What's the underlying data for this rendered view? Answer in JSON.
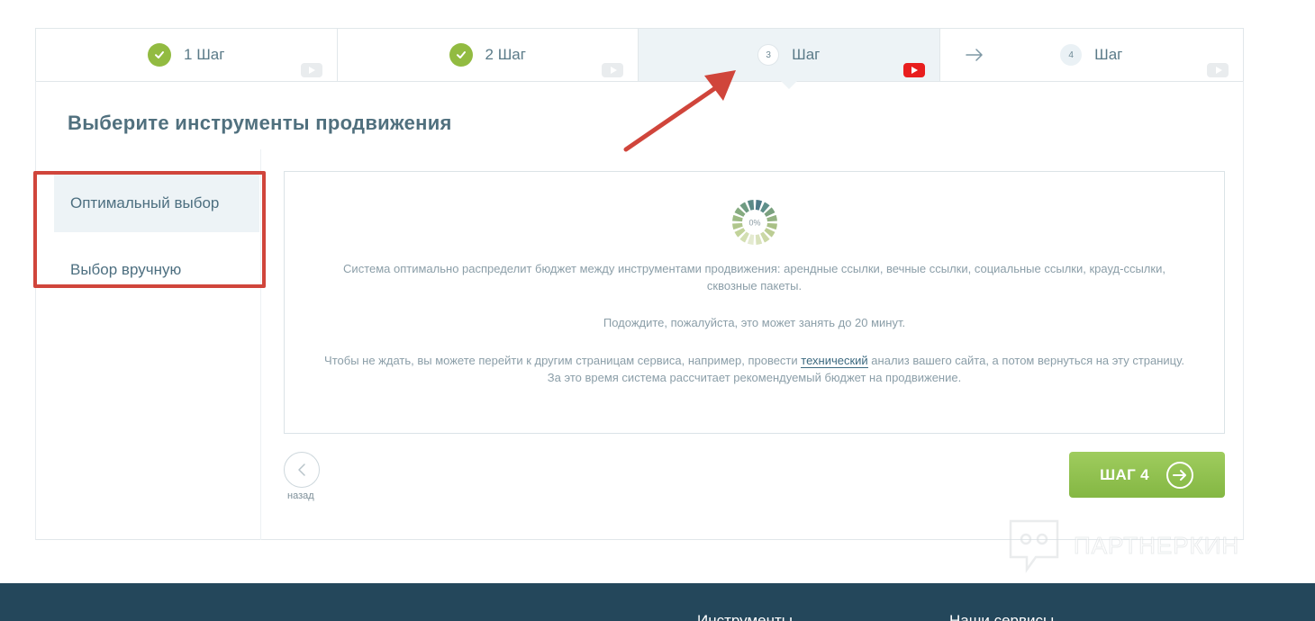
{
  "steps": [
    {
      "label": "1 Шаг",
      "state": "done",
      "icon": "check-icon",
      "video_icon": "youtube-icon"
    },
    {
      "label": "2 Шаг",
      "state": "done",
      "icon": "check-icon",
      "video_icon": "youtube-icon"
    },
    {
      "number": "3",
      "label": "Шаг",
      "state": "active",
      "video_icon": "youtube-icon",
      "video_color": "#e81e1e"
    },
    {
      "number": "4",
      "label": "Шаг",
      "state": "pending",
      "prefix_icon": "arrow-right-icon",
      "video_icon": "youtube-icon"
    }
  ],
  "page_title": "Выберите инструменты продвижения",
  "options": {
    "optimal": "Оптимальный выбор",
    "manual": "Выбор вручную"
  },
  "loader": {
    "progress_label": "0%",
    "progress_value": 0
  },
  "messages": {
    "p1": "Система оптимально распределит бюджет между инструментами продвижения: арендные ссылки, вечные ссылки, социальные ссылки, крауд-ссылки, сквозные пакеты.",
    "p2": "Подождите, пожалуйста, это может занять до 20 минут.",
    "p3_before": "Чтобы не ждать, вы можете перейти к другим страницам сервиса, например, провести ",
    "p3_link": "технический",
    "p3_after": " анализ вашего сайта, а потом вернуться на эту страницу. За это время система рассчитает рекомендуемый бюджет на продвижение."
  },
  "nav": {
    "back_label": "назад",
    "next_label": "ШАГ 4"
  },
  "watermark": "ПАРТНЕРКИН",
  "footer": {
    "col1": "Инструменты",
    "col2": "Наши сервисы"
  },
  "colors": {
    "accent_green": "#92bb41",
    "highlight_red": "#d0453b",
    "footer_bg": "#24475b"
  }
}
